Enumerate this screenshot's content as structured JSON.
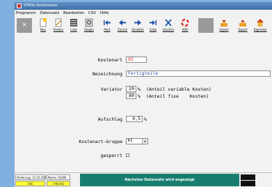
{
  "window": {
    "title": "STM1k Kostenarten"
  },
  "menu": [
    "Programm",
    "Datensatz",
    "Bearbeiten",
    "CSV",
    "Hilfe"
  ],
  "toolbar": {
    "close_glyph": "×",
    "buttons": [
      {
        "label": "Neu"
      },
      {
        "label": "Ändern"
      },
      {
        "label": "Liste"
      },
      {
        "label": "Zeigen"
      },
      {
        "label": "Pos1"
      },
      {
        "label": "Zurück"
      },
      {
        "label": "Vorwärts"
      },
      {
        "label": "Ende"
      },
      {
        "label": "Löschen"
      },
      {
        "label": "Hilfe"
      },
      {
        "label": "Import"
      },
      {
        "label": "Export"
      },
      {
        "label": "Eigenden"
      }
    ]
  },
  "form": {
    "kostenart": {
      "label": "Kostenart",
      "value": "0Z"
    },
    "bezeichnung": {
      "label": "Bezeichnung",
      "value": "Fertigteile"
    },
    "variator": {
      "label": "Variator",
      "variable_value": "20",
      "variable_unit": "%",
      "variable_note": "(Anteil variable Kosten)",
      "fixed_value": "80",
      "fixed_unit": "%",
      "fixed_note": "(Anteil fixe    Kosten)"
    },
    "aufschlag": {
      "label": "Aufschlag",
      "value": "0,5",
      "unit": "%"
    },
    "gruppe": {
      "label": "Kostenart-Gruppe",
      "value": "K1"
    },
    "gesperrt": {
      "label": "gesperrt",
      "checked": false
    }
  },
  "status": {
    "aenderung": "Änderung: 12.10.2011",
    "name": "Name: QUAN",
    "code1": "QSE",
    "code2": "/ INGRID",
    "message": "Nächsten Datensatz wird angezeigt",
    "green1": "",
    "green2": ""
  }
}
